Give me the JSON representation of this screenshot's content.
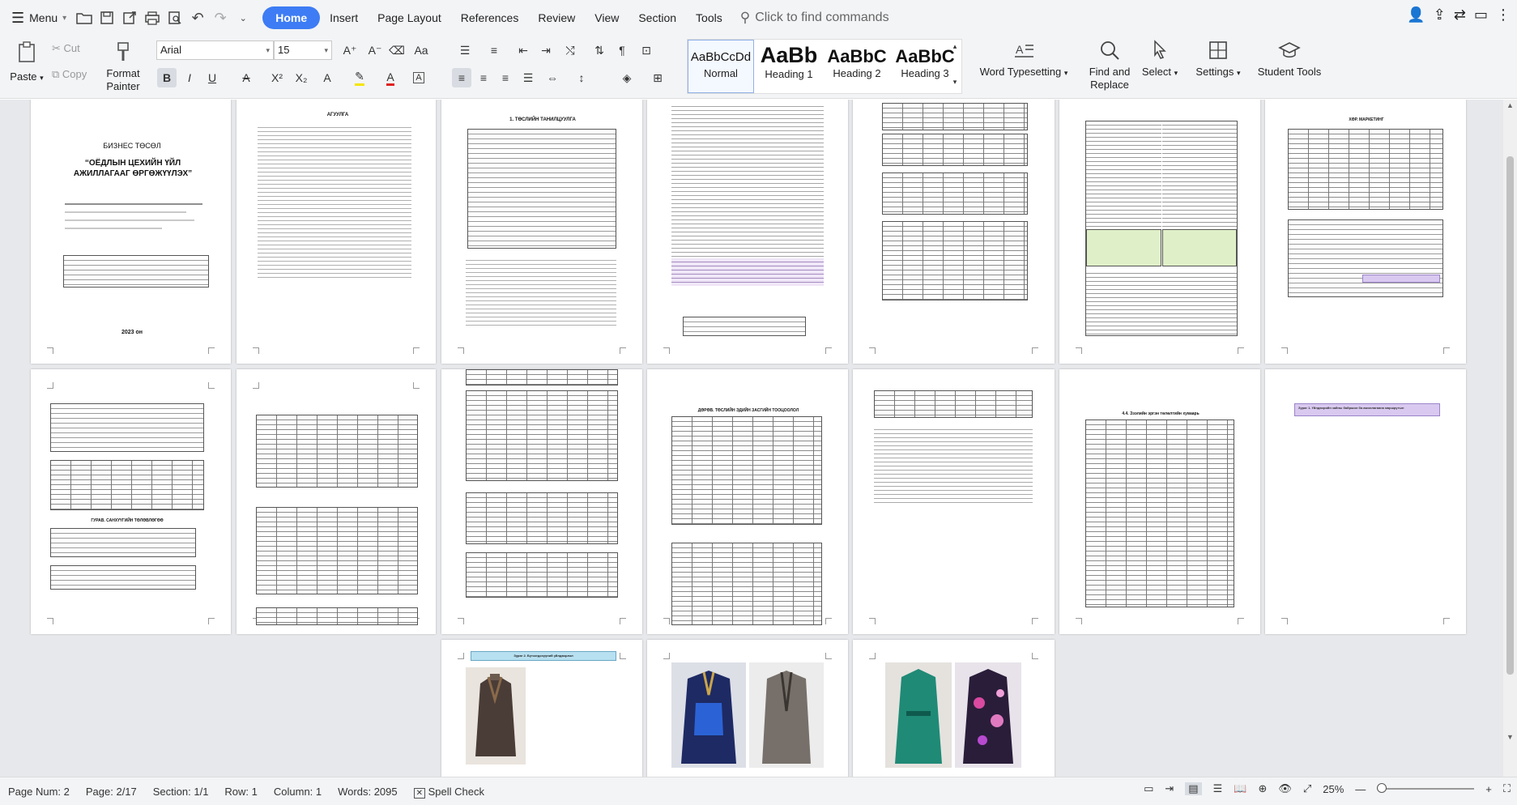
{
  "menubar": {
    "menu_label": "Menu",
    "tabs": [
      {
        "label": "Home",
        "active": true
      },
      {
        "label": "Insert"
      },
      {
        "label": "Page Layout"
      },
      {
        "label": "References"
      },
      {
        "label": "Review"
      },
      {
        "label": "View"
      },
      {
        "label": "Section"
      },
      {
        "label": "Tools"
      }
    ],
    "find_placeholder": "Click to find commands"
  },
  "ribbon": {
    "paste": "Paste",
    "cut": "Cut",
    "copy": "Copy",
    "format_painter": "Format Painter",
    "font_name": "Arial",
    "font_size": "15",
    "styles": [
      {
        "sample": "AaBbCcDd",
        "label": "Normal"
      },
      {
        "sample": "AaBb",
        "label": "Heading 1"
      },
      {
        "sample": "AaBbC",
        "label": "Heading 2"
      },
      {
        "sample": "AaBbC",
        "label": "Heading 3"
      }
    ],
    "word_typesetting": "Word Typesetting",
    "find_replace": "Find and Replace",
    "select": "Select",
    "settings": "Settings",
    "student_tools": "Student Tools"
  },
  "document": {
    "page1_title": "БИЗНЕС ТӨСӨЛ",
    "page1_subtitle": "“ОЁДЛЫН ЦЕХИЙН ҮЙЛ АЖИЛЛАГААГ ӨРГӨЖҮҮЛЭХ”",
    "page1_year": "2023 он",
    "page2_title": "АГУУЛГА",
    "page3_title": "1. ТӨСЛИЙН ТАНИЛЦУУЛГА",
    "page7_title": "ХӨР. МАРКЕТИНГ",
    "page8_section": "ГУРАВ. САНХҮҮГИЙН ТӨЛӨВЛӨГӨӨ",
    "page10_section": "ДӨРӨВ. ТӨСЛИЙН ЭДИЙН ЗАСГИЙН ТООЦООЛОЛ",
    "page12_heading": "4.4. Зээлийн эргэн төлөлтийн хуваарь",
    "page13_box": "Зураг 1. Үйлдвэрийн зайны байршил ба ажиллагаана маршрутын",
    "page14_box": "Зураг 2. Бүтээгдэхүүний үйлдвэрлэл"
  },
  "status": {
    "page_num": "Page Num: 2",
    "page": "Page: 2/17",
    "section": "Section: 1/1",
    "row": "Row: 1",
    "column": "Column: 1",
    "words": "Words: 2095",
    "spell_check": "Spell Check",
    "zoom": "25%"
  },
  "colors": {
    "accent": "#3d7cf4",
    "doc_background": "#e7e8eb"
  }
}
